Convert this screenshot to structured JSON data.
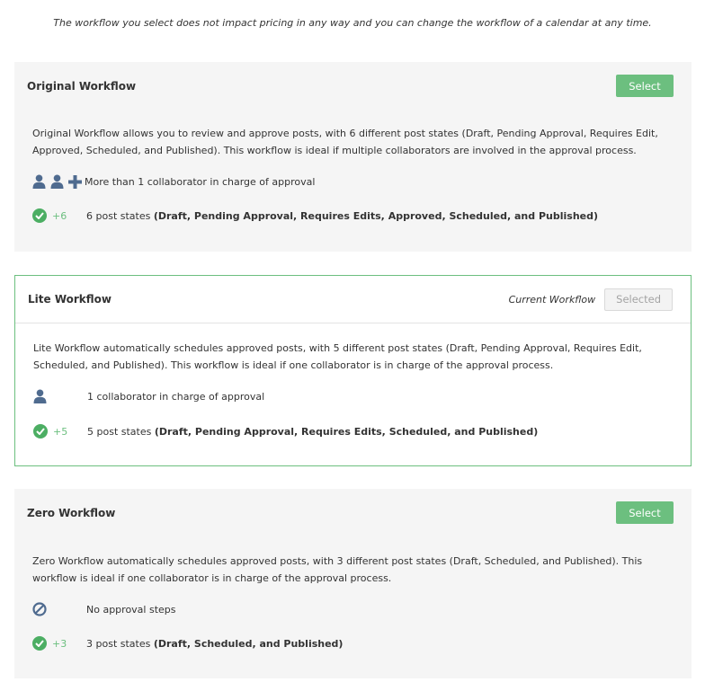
{
  "note": "The workflow you select does not impact pricing in any way and you can change the workflow of a calendar at any time.",
  "workflows": [
    {
      "title": "Original Workflow",
      "button": "Select",
      "description": "Original Workflow allows you to review and approve posts, with 6 different post states (Draft, Pending Approval, Requires Edit, Approved, Scheduled, and Published). This workflow is ideal if multiple collaborators are involved in the approval process.",
      "collaborators_text": "More than 1 collaborator in charge of approval",
      "states_count": "+6",
      "states_text": "6 post states ",
      "states_list": "(Draft, Pending Approval, Requires Edits, Approved, Scheduled, and Published)",
      "icons": [
        "user-icon",
        "user-icon",
        "plus-icon",
        "check-circle-icon"
      ]
    },
    {
      "title": "Lite Workflow",
      "current_label": "Current Workflow",
      "button": "Selected",
      "description": "Lite Workflow automatically schedules approved posts, with 5 different post states (Draft, Pending Approval, Requires Edit, Scheduled, and Published). This workflow is ideal if one collaborator is in charge of the approval process.",
      "collaborators_text": "1 collaborator in charge of approval",
      "states_count": "+5",
      "states_text": "5 post states ",
      "states_list": "(Draft, Pending Approval, Requires Edits, Scheduled, and Published)",
      "icons": [
        "user-icon",
        "check-circle-icon"
      ]
    },
    {
      "title": "Zero Workflow",
      "button": "Select",
      "description": "Zero Workflow automatically schedules approved posts, with 3 different post states (Draft, Scheduled, and Published). This workflow is ideal if one collaborator is in charge of the approval process.",
      "collaborators_text": "No approval steps",
      "states_count": "+3",
      "states_text": "3 post states ",
      "states_list": "(Draft, Scheduled, and Published)",
      "icons": [
        "prohibited-icon",
        "check-circle-icon"
      ]
    }
  ],
  "colors": {
    "accent_green": "#6cbf7f",
    "check_green": "#4cae63",
    "user_icon_blue": "#4f6b8f",
    "card_bg": "#f5f5f5",
    "selected_border": "#6cbf7f"
  }
}
